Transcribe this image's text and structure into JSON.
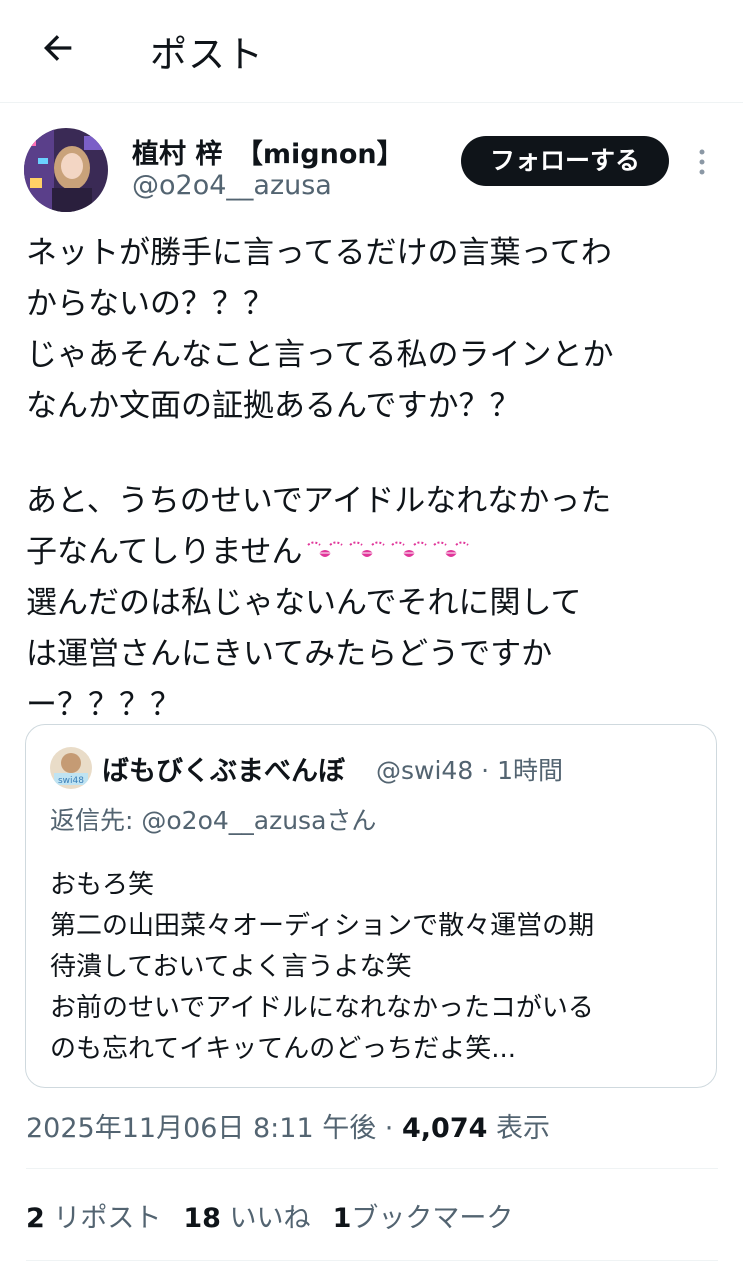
{
  "header": {
    "title": "ポスト"
  },
  "author": {
    "display_name": "植村 梓　【mignon】",
    "handle": "@o2o4__azusa",
    "follow_label": "フォローする"
  },
  "tweet": {
    "lines": [
      "ネットが勝手に言ってるだけの言葉ってわ",
      "からないの？？？",
      "じゃあそんなこと言ってる私のラインとか",
      "なんか文面の証拠あるんですか？？",
      "",
      "あと、うちのせいでアイドルなれなかった",
      "子なんてしりません",
      "選んだのは私じゃないんでそれに関して",
      "は運営さんにきいてみたらどうですか",
      "ー？？？？"
    ],
    "emoji": "kissing-face-icons",
    "emoji_count": 4
  },
  "quote": {
    "name": "ばもびくぶまべんぼ",
    "meta": "@swi48 · 1時間",
    "avatar_label": "swi48",
    "reply_to": "返信先: @o2o4__azusaさん",
    "lines": [
      "おもろ笑",
      "第二の山田菜々オーディションで散々運営の期",
      "待潰しておいてよく言うよな笑",
      "お前のせいでアイドルになれなかったコがいる",
      "のも忘れてイキッてんのどっちだよ笑..."
    ]
  },
  "meta": {
    "timestamp": "2025年11月06日 8:11 午後 · ",
    "views": "4,074",
    "views_label": " 表示"
  },
  "stats": {
    "reposts_count": "2",
    "reposts_label": " リポスト",
    "likes_count": "18",
    "likes_label": " いいね",
    "bookmarks_count": "1",
    "bookmarks_label": "ブックマーク"
  },
  "colors": {
    "text": "#0f1419",
    "secondary": "#536471",
    "border": "#cfd9de",
    "emoji_pink": "#e0369a"
  }
}
